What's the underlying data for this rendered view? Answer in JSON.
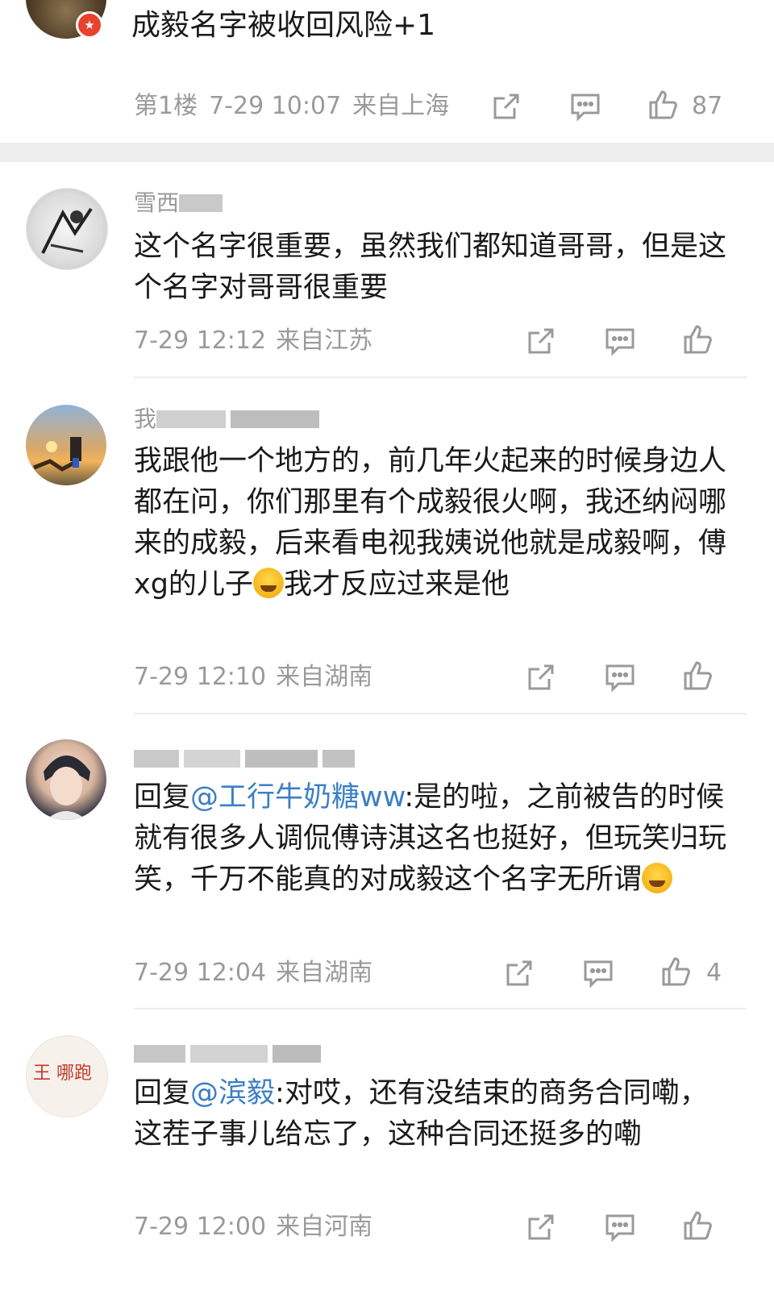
{
  "top_comment": {
    "text": "成毅名字被收回风险+1",
    "floor": "第1楼",
    "time": "7-29 10:07",
    "location": "来自上海",
    "likes": "87"
  },
  "comments": [
    {
      "username": "雪西",
      "text": "这个名字很重要，虽然我们都知道哥哥，但是这个名字对哥哥很重要",
      "time": "7-29 12:12",
      "location": "来自江苏",
      "likes": ""
    },
    {
      "username": "我",
      "text_before_emoji": "我跟他一个地方的，前几年火起来的时候身边人都在问，你们那里有个成毅很火啊，我还纳闷哪来的成毅，后来看电视我姨说他就是成毅啊，傅xg的儿子",
      "text_after_emoji": "我才反应过来是他",
      "time": "7-29 12:10",
      "location": "来自湖南",
      "likes": ""
    },
    {
      "username": "",
      "reply_prefix": "回复",
      "mention": "@工行牛奶糖ww",
      "text_before_emoji": ":是的啦，之前被告的时候就有很多人调侃傅诗淇这名也挺好，但玩笑归玩笑，千万不能真的对成毅这个名字无所谓",
      "time": "7-29 12:04",
      "location": "来自湖南",
      "likes": "4"
    },
    {
      "username": "",
      "reply_prefix": "回复",
      "mention": "@滨毅",
      "text_before_emoji": ":对哎，还有没结束的商务合同嘞，这茬子事儿给忘了，这种合同还挺多的嘞",
      "time": "7-29 12:00",
      "location": "来自河南",
      "likes": ""
    }
  ],
  "avatar_texts": {
    "comment4_avatar": "王 哪跑"
  },
  "icons": [
    "share-icon",
    "comment-icon",
    "like-icon",
    "verified-badge-icon"
  ],
  "colors": {
    "mention": "#3b7fc4",
    "meta_gray": "#9a9a9a",
    "gap_bar": "#ededed",
    "badge_red": "#e8412c"
  }
}
